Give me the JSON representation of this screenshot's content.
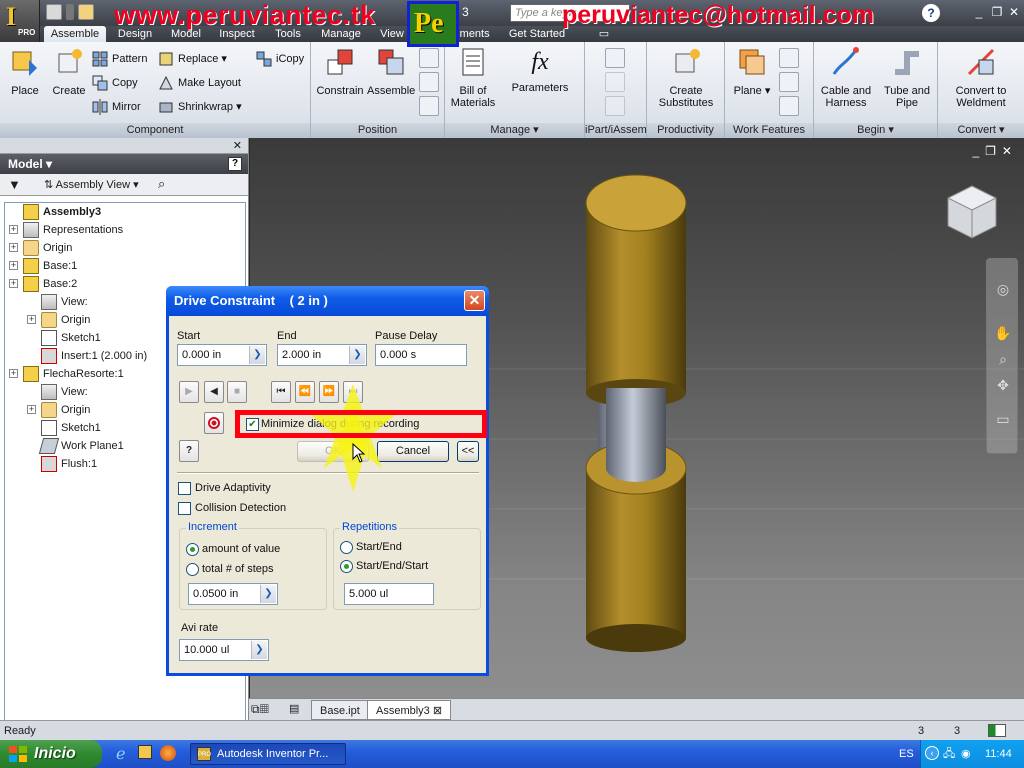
{
  "window": {
    "title_fragment": "3",
    "search_placeholder": "Type a keyw",
    "help_label": "?"
  },
  "watermarks": {
    "left_text": "www.peruviantec.tk",
    "right_text": "peruviantec@hotmail.com",
    "logo_text": "Pe"
  },
  "app_button": {
    "badge": "PRO"
  },
  "tabs": [
    {
      "label": "Assemble"
    },
    {
      "label": "Design"
    },
    {
      "label": "Model"
    },
    {
      "label": "Inspect"
    },
    {
      "label": "Tools"
    },
    {
      "label": "Manage"
    },
    {
      "label": "View"
    },
    {
      "label": "Environments"
    },
    {
      "label": "Get Started"
    }
  ],
  "ribbon": {
    "component": {
      "label": "Component",
      "place": "Place",
      "create": "Create",
      "pattern": "Pattern",
      "copy": "Copy",
      "mirror": "Mirror",
      "replace": "Replace",
      "make_layout": "Make Layout",
      "shrinkwrap": "Shrinkwrap",
      "icopy": "iCopy"
    },
    "position": {
      "label": "Position",
      "constrain": "Constrain",
      "assemble": "Assemble"
    },
    "manage": {
      "label": "Manage",
      "bill_line1": "Bill of",
      "bill_line2": "Materials",
      "parameters": "Parameters"
    },
    "ipart": {
      "label": "iPart/iAssembly"
    },
    "productivity": {
      "label": "Productivity",
      "create_sub_line1": "Create",
      "create_sub_line2": "Substitutes"
    },
    "work_features": {
      "label": "Work Features",
      "plane": "Plane"
    },
    "begin": {
      "label": "Begin",
      "cable_line1": "Cable and",
      "cable_line2": "Harness",
      "tube_line1": "Tube and",
      "tube_line2": "Pipe"
    },
    "convert": {
      "label": "Convert",
      "convert_line1": "Convert to",
      "convert_line2": "Weldment"
    }
  },
  "browser": {
    "header": "Model",
    "help_label": "?",
    "view_selector": "Assembly View",
    "tree": [
      {
        "label": "Assembly3",
        "level": 0,
        "icon": "assembly-icon",
        "expander": false,
        "bold": true
      },
      {
        "label": "Representations",
        "level": 0,
        "icon": "representations-icon",
        "expander": true
      },
      {
        "label": "Origin",
        "level": 0,
        "icon": "folder-icon",
        "expander": true
      },
      {
        "label": "Base:1",
        "level": 0,
        "icon": "part-icon",
        "expander": true
      },
      {
        "label": "Base:2",
        "level": 0,
        "icon": "part-icon",
        "expander": true
      },
      {
        "label": "View:",
        "level": 1,
        "icon": "view-icon",
        "expander": false
      },
      {
        "label": "Origin",
        "level": 1,
        "icon": "folder-icon",
        "expander": true
      },
      {
        "label": "Sketch1",
        "level": 1,
        "icon": "sketch-icon",
        "expander": false
      },
      {
        "label": "Insert:1 (2.000 in)",
        "level": 1,
        "icon": "insert-icon",
        "expander": false
      },
      {
        "label": "FlechaResorte:1",
        "level": 0,
        "icon": "part-icon",
        "expander": true
      },
      {
        "label": "View:",
        "level": 1,
        "icon": "view-icon",
        "expander": false
      },
      {
        "label": "Origin",
        "level": 1,
        "icon": "folder-icon",
        "expander": true
      },
      {
        "label": "Sketch1",
        "level": 1,
        "icon": "sketch-icon",
        "expander": false
      },
      {
        "label": "Work Plane1",
        "level": 1,
        "icon": "plane-icon",
        "expander": false
      },
      {
        "label": "Flush:1",
        "level": 1,
        "icon": "flush-icon",
        "expander": false
      }
    ]
  },
  "dialog": {
    "title": "Drive Constraint    ( 2 in )",
    "start_label": "Start",
    "start_value": "0.000 in",
    "end_label": "End",
    "end_value": "2.000 in",
    "pause_label": "Pause Delay",
    "pause_value": "0.000 s",
    "minimize_label": "Minimize dialog during recording",
    "minimize_checked": true,
    "ok_label": "OK",
    "cancel_label": "Cancel",
    "more_label": "<<",
    "help_label": "?",
    "drive_adaptivity": "Drive Adaptivity",
    "collision_detection": "Collision Detection",
    "increment_title": "Increment",
    "amount_of_value": "amount of value",
    "total_steps": "total # of steps",
    "increment_value": "0.0500 in",
    "repetitions_title": "Repetitions",
    "start_end": "Start/End",
    "start_end_start": "Start/End/Start",
    "repetitions_value": "5.000 ul",
    "avi_label": "Avi rate",
    "avi_value": "10.000 ul"
  },
  "doc_tabs": [
    {
      "label": "Base.ipt"
    },
    {
      "label": "Assembly3"
    }
  ],
  "status": {
    "text": "Ready",
    "count1": "3",
    "count2": "3"
  },
  "taskbar": {
    "start": "Inicio",
    "task_label": "Autodesk Inventor Pr...",
    "lang": "ES",
    "clock": "11:44"
  },
  "colors": {
    "accent": "#0a4be0",
    "highlight": "#ff0010",
    "watermark": "#f00020",
    "part_gold": "#c9a23a"
  }
}
